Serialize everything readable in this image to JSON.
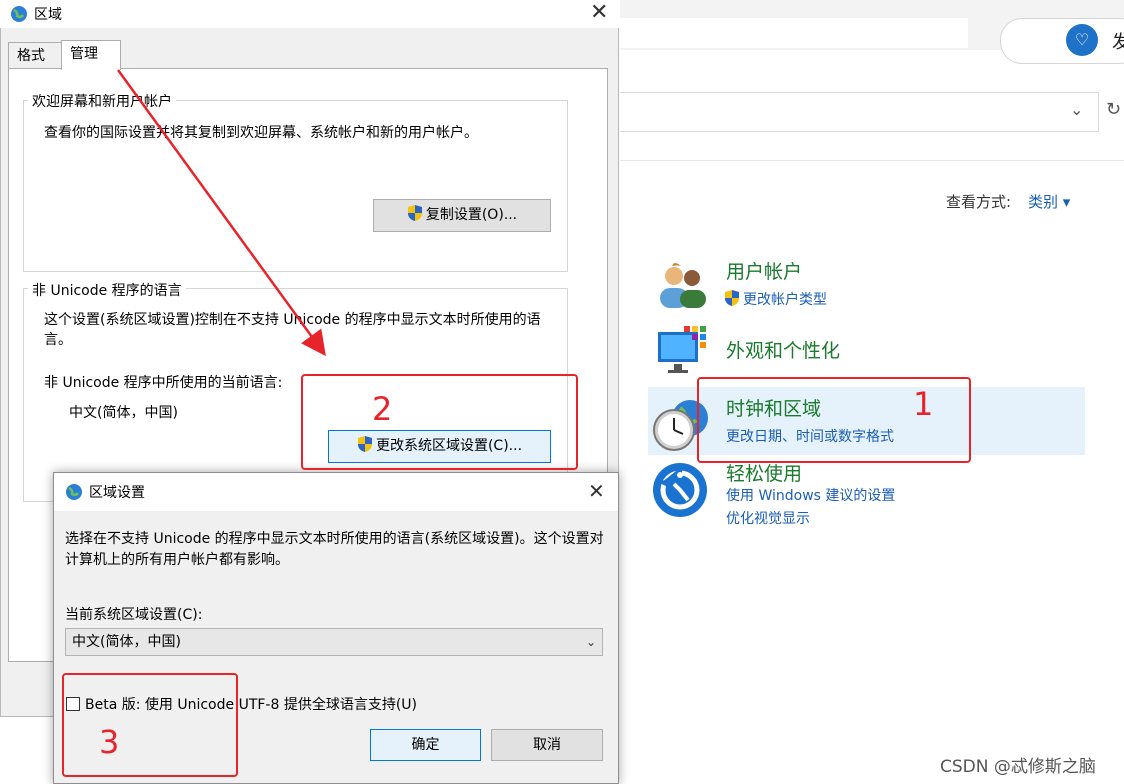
{
  "control_panel": {
    "user_button_text": "发",
    "view_by_label": "查看方式:",
    "view_by_value": "类别 ▾",
    "categories": [
      {
        "title": "用户帐户",
        "links": [
          "更改帐户类型"
        ]
      },
      {
        "title": "外观和个性化",
        "links": []
      },
      {
        "title": "时钟和区域",
        "links": [
          "更改日期、时间或数字格式"
        ]
      },
      {
        "title": "轻松使用",
        "links": [
          "使用 Windows 建议的设置",
          "优化视觉显示"
        ]
      }
    ]
  },
  "region_dialog": {
    "title": "区域",
    "tabs": [
      "格式",
      "管理"
    ],
    "active_tab": "管理",
    "welcome_group": {
      "legend": "欢迎屏幕和新用户帐户",
      "description": "查看你的国际设置并将其复制到欢迎屏幕、系统帐户和新的用户帐户。",
      "button": "复制设置(O)..."
    },
    "non_unicode_group": {
      "legend": "非 Unicode 程序的语言",
      "description": "这个设置(系统区域设置)控制在不支持 Unicode 的程序中显示文本时所使用的语言。",
      "current_label": "非 Unicode 程序中所使用的当前语言:",
      "current_value": "中文(简体，中国)",
      "button": "更改系统区域设置(C)..."
    }
  },
  "region_settings_dialog": {
    "title": "区域设置",
    "description": "选择在不支持 Unicode 的程序中显示文本时所使用的语言(系统区域设置)。这个设置对计算机上的所有用户帐户都有影响。",
    "current_label": "当前系统区域设置(C):",
    "current_value": "中文(简体，中国)",
    "beta_checkbox": "Beta 版: 使用 Unicode UTF-8 提供全球语言支持(U)",
    "beta_checked": false,
    "ok": "确定",
    "cancel": "取消"
  },
  "annotations": {
    "one": "1",
    "two": "2",
    "three": "3",
    "color": "#e8242b"
  },
  "watermark": "CSDN @忒修斯之脑"
}
